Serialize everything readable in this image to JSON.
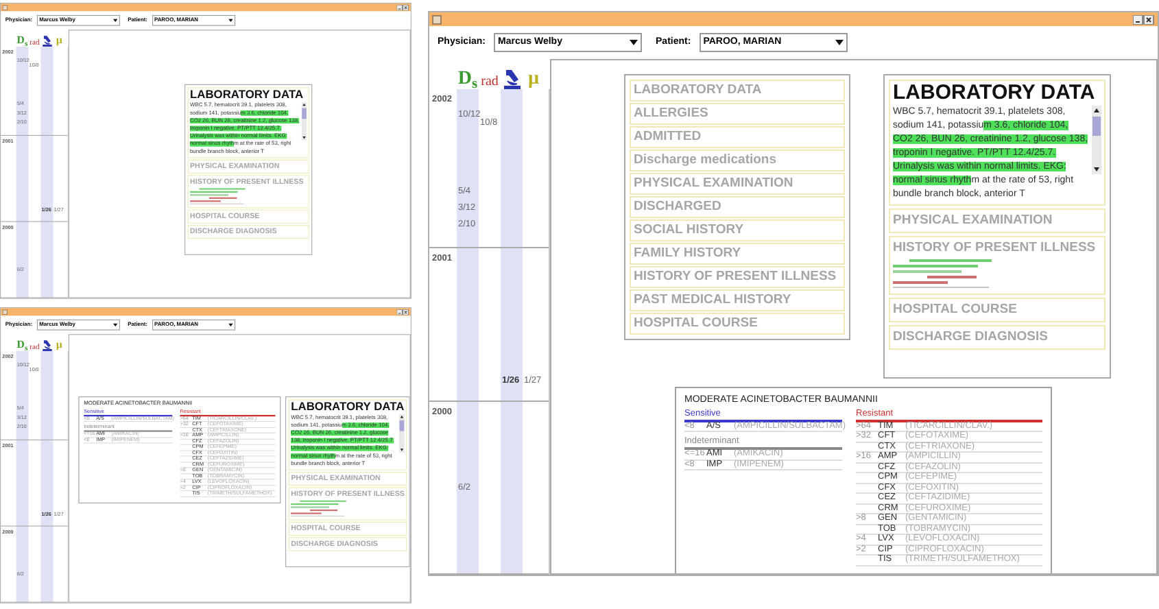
{
  "windows": [
    {
      "physician": {
        "label": "Physician:",
        "value": "Marcus Welby"
      },
      "patient": {
        "label": "Patient:",
        "value": "PAROO, MARIAN"
      },
      "sources": [
        {
          "kind": "ds",
          "label": "D$_{s}$"
        },
        {
          "kind": "rad",
          "label": "rad"
        },
        {
          "kind": "micro"
        },
        {
          "kind": "mu",
          "label": "µ"
        }
      ],
      "years": [
        {
          "label": "2002",
          "events": [
            {
              "label": "10/12",
              "kind": "ds"
            },
            {
              "label": "10/8",
              "kind": "rad"
            },
            {
              "label": "5/4",
              "kind": "ds"
            },
            {
              "label": "3/12",
              "kind": "ds"
            },
            {
              "label": "2/10",
              "kind": "ds"
            }
          ]
        },
        {
          "label": "2001",
          "events": [
            {
              "label": "1/26",
              "kind": "micro"
            },
            {
              "label": "1/27",
              "kind": "mu"
            }
          ]
        },
        {
          "label": "2000",
          "events": [
            {
              "label": "6/2",
              "kind": "ds"
            }
          ]
        }
      ],
      "note": {
        "title": "LABORATORY DATA",
        "text_before": "WBC 5.7, hematocrit 39.1, platelets 308, sodium 141, potassiu",
        "text_highlight": "m 3.6, chloride 104, CO2 26, BUN 26, creatinine 1.2, glucose 138, troponin I negative. PT/PTT 12.4/25.7. Urinalysis was within normal limits. EKG: normal sinus rhyth",
        "text_after": "m at the rate of 53, right bundle branch block, anterior T",
        "sections": [
          {
            "label": "PHYSICAL EXAMINATION",
            "kind": "plain"
          },
          {
            "label": "HISTORY OF PRESENT ILLNESS",
            "kind": "summary"
          },
          {
            "label": "HOSPITAL COURSE",
            "kind": "plain"
          },
          {
            "label": "DISCHARGE DIAGNOSIS",
            "kind": "plain"
          }
        ]
      }
    },
    {
      "physician": {
        "label": "Physician:",
        "value": "Marcus Welby"
      },
      "patient": {
        "label": "Patient:",
        "value": "PAROO, MARIAN"
      },
      "sources": [
        {
          "kind": "ds",
          "label": "D$_{s}$"
        },
        {
          "kind": "rad",
          "label": "rad"
        },
        {
          "kind": "micro"
        },
        {
          "kind": "mu",
          "label": "µ"
        }
      ],
      "years": [
        {
          "label": "2002",
          "events": [
            {
              "label": "10/12",
              "kind": "ds"
            },
            {
              "label": "10/8",
              "kind": "rad"
            },
            {
              "label": "5/4",
              "kind": "ds"
            },
            {
              "label": "3/12",
              "kind": "ds"
            },
            {
              "label": "2/10",
              "kind": "ds"
            }
          ]
        },
        {
          "label": "2001",
          "events": [
            {
              "label": "1/26",
              "kind": "micro"
            },
            {
              "label": "1/27",
              "kind": "mu"
            }
          ]
        },
        {
          "label": "2000",
          "events": [
            {
              "label": "6/2",
              "kind": "ds"
            }
          ]
        }
      ],
      "organism": {
        "title": "MODERATE ACINETOBACTER BAUMANNII",
        "groups": [
          {
            "label": "Sensitive",
            "color": "#3a3ad0",
            "rows": [
              {
                "mic": "<8",
                "code": "A/S",
                "name": "(AMPICILLIN/SULBACTAM)"
              }
            ]
          },
          {
            "label": "Indeterminant",
            "color": "#888888",
            "rows": [
              {
                "mic": "<=16",
                "code": "AMI",
                "name": "(AMIKACIN)"
              },
              {
                "mic": "<8",
                "code": "IMP",
                "name": "(IMIPENEM)"
              }
            ]
          },
          {
            "label": "Resistant",
            "color": "#d03030",
            "rows": [
              {
                "mic": ">64",
                "code": "TIM",
                "name": "(TICARCILLIN/CLAV.)"
              },
              {
                "mic": ">32",
                "code": "CFT",
                "name": "(CEFOTAXIME)"
              },
              {
                "code": "CTX",
                "name": "(CEFTRIAXONE)"
              },
              {
                "mic": ">16",
                "code": "AMP",
                "name": "(AMPICILLIN)"
              },
              {
                "code": "CFZ",
                "name": "(CEFAZOLIN)"
              },
              {
                "code": "CPM",
                "name": "(CEFEPIME)"
              },
              {
                "code": "CFX",
                "name": "(CEFOXITIN)"
              },
              {
                "code": "CEZ",
                "name": "(CEFTAZIDIME)"
              },
              {
                "code": "CRM",
                "name": "(CEFUROXIME)"
              },
              {
                "mic": ">8",
                "code": "GEN",
                "name": "(GENTAMICIN)"
              },
              {
                "code": "TOB",
                "name": "(TOBRAMYCIN)"
              },
              {
                "mic": ">4",
                "code": "LVX",
                "name": "(LEVOFLOXACIN)"
              },
              {
                "mic": ">2",
                "code": "CIP",
                "name": "(CIPROFLOXACIN)"
              },
              {
                "code": "TIS",
                "name": "(TRIMETH/SULFAMETHOX)"
              }
            ]
          }
        ]
      },
      "note": {
        "title": "LABORATORY DATA",
        "text_before": "WBC 5.7, hematocrit 39.1, platelets 308, sodium 141, potassiu",
        "text_highlight": "m 3.6, chloride 104, CO2 26, BUN 26, creatinine 1.2, glucose 138, troponin I negative. PT/PTT 12.4/25.7. Urinalysis was within normal limits. EKG: normal sinus rhyth",
        "text_after": "m at the rate of 53, right bundle branch block, anterior T",
        "sections": [
          {
            "label": "PHYSICAL EXAMINATION",
            "kind": "plain"
          },
          {
            "label": "HISTORY OF PRESENT ILLNESS",
            "kind": "summary"
          },
          {
            "label": "HOSPITAL COURSE",
            "kind": "plain"
          },
          {
            "label": "DISCHARGE DIAGNOSIS",
            "kind": "plain"
          }
        ]
      }
    },
    {
      "physician": {
        "label": "Physician:",
        "value": "Marcus Welby"
      },
      "patient": {
        "label": "Patient:",
        "value": "PAROO, MARIAN"
      },
      "sources": [
        {
          "kind": "ds",
          "label": "D$_{s}$"
        },
        {
          "kind": "rad",
          "label": "rad"
        },
        {
          "kind": "micro"
        },
        {
          "kind": "mu",
          "label": "µ"
        }
      ],
      "years": [
        {
          "label": "2002",
          "events": [
            {
              "label": "10/12",
              "kind": "ds"
            },
            {
              "label": "10/8",
              "kind": "rad"
            },
            {
              "label": "5/4",
              "kind": "ds"
            },
            {
              "label": "3/12",
              "kind": "ds"
            },
            {
              "label": "2/10",
              "kind": "ds"
            }
          ]
        },
        {
          "label": "2001",
          "events": [
            {
              "label": "1/26",
              "kind": "micro"
            },
            {
              "label": "1/27",
              "kind": "mu"
            }
          ]
        },
        {
          "label": "2000",
          "events": [
            {
              "label": "6/2",
              "kind": "ds"
            }
          ]
        }
      ],
      "index": [
        "LABORATORY DATA",
        "ALLERGIES",
        "ADMITTED",
        "Discharge medications",
        "PHYSICAL EXAMINATION",
        "DISCHARGED",
        "SOCIAL HISTORY",
        "FAMILY HISTORY",
        "HISTORY OF PRESENT ILLNESS",
        "PAST MEDICAL HISTORY",
        "HOSPITAL COURSE"
      ],
      "note": {
        "title": "LABORATORY DATA",
        "text_before": "WBC 5.7, hematocrit 39.1, platelets 308, sodium 141, potassiu",
        "text_highlight": "m 3.6, chloride 104, CO2 26, BUN 26, creatinine 1.2, glucose 138, troponin I negative. PT/PTT 12.4/25.7. Urinalysis was within normal limits. EKG: normal sinus rhyth",
        "text_after": "m at the rate of 53, right bundle branch block, anterior T",
        "sections": [
          {
            "label": "PHYSICAL EXAMINATION",
            "kind": "plain"
          },
          {
            "label": "HISTORY OF PRESENT ILLNESS",
            "kind": "summary"
          },
          {
            "label": "HOSPITAL COURSE",
            "kind": "plain"
          },
          {
            "label": "DISCHARGE DIAGNOSIS",
            "kind": "plain"
          }
        ]
      },
      "organism": {
        "title": "MODERATE ACINETOBACTER BAUMANNII",
        "groups": [
          {
            "label": "Sensitive",
            "color": "#3a3ad0",
            "rows": [
              {
                "mic": "<8",
                "code": "A/S",
                "name": "(AMPICILLIN/SULBACTAM)"
              }
            ]
          },
          {
            "label": "Indeterminant",
            "color": "#888888",
            "rows": [
              {
                "mic": "<=16",
                "code": "AMI",
                "name": "(AMIKACIN)"
              },
              {
                "mic": "<8",
                "code": "IMP",
                "name": "(IMIPENEM)"
              }
            ]
          },
          {
            "label": "Resistant",
            "color": "#d03030",
            "rows": [
              {
                "mic": ">64",
                "code": "TIM",
                "name": "(TICARCILLIN/CLAV.)"
              },
              {
                "mic": ">32",
                "code": "CFT",
                "name": "(CEFOTAXIME)"
              },
              {
                "code": "CTX",
                "name": "(CEFTRIAXONE)"
              },
              {
                "mic": ">16",
                "code": "AMP",
                "name": "(AMPICILLIN)"
              },
              {
                "code": "CFZ",
                "name": "(CEFAZOLIN)"
              },
              {
                "code": "CPM",
                "name": "(CEFEPIME)"
              },
              {
                "code": "CFX",
                "name": "(CEFOXITIN)"
              },
              {
                "code": "CEZ",
                "name": "(CEFTAZIDIME)"
              },
              {
                "code": "CRM",
                "name": "(CEFUROXIME)"
              },
              {
                "mic": ">8",
                "code": "GEN",
                "name": "(GENTAMICIN)"
              },
              {
                "code": "TOB",
                "name": "(TOBRAMYCIN)"
              },
              {
                "mic": ">4",
                "code": "LVX",
                "name": "(LEVOFLOXACIN)"
              },
              {
                "mic": ">2",
                "code": "CIP",
                "name": "(CIPROFLOXACIN)"
              },
              {
                "code": "TIS",
                "name": "(TRIMETH/SULFAMETHOX)"
              }
            ]
          }
        ]
      }
    }
  ]
}
